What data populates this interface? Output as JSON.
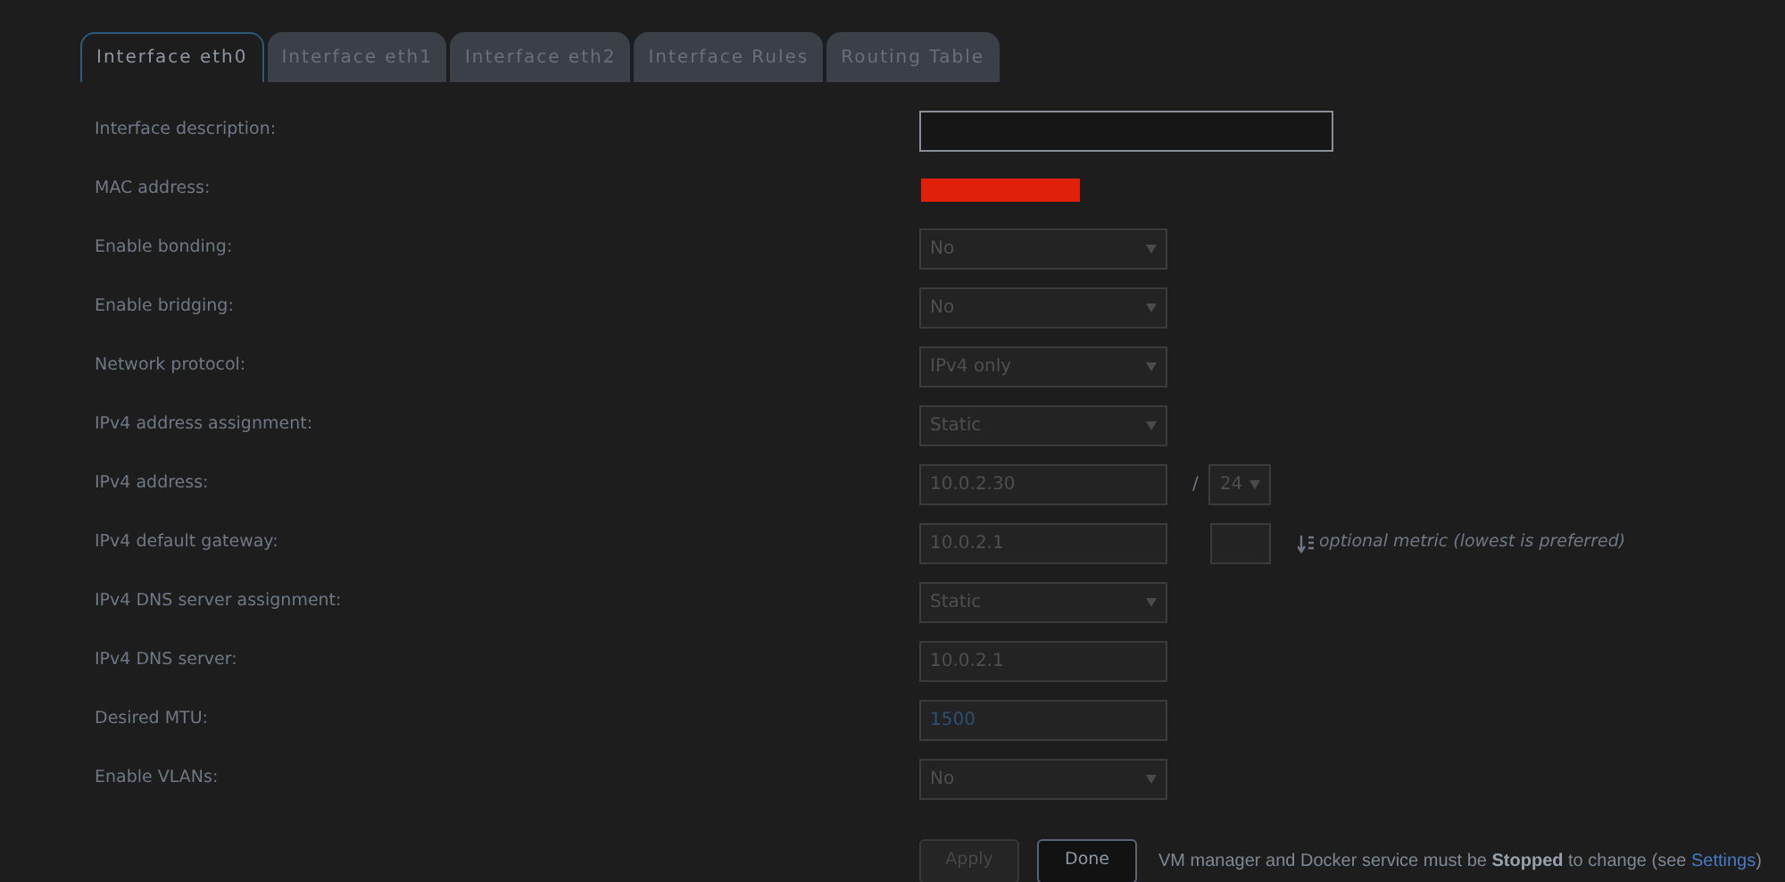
{
  "tabs": [
    {
      "label": "Interface eth0",
      "selected": true
    },
    {
      "label": "Interface eth1",
      "selected": false
    },
    {
      "label": "Interface eth2",
      "selected": false
    },
    {
      "label": "Interface Rules",
      "selected": false
    },
    {
      "label": "Routing Table",
      "selected": false
    }
  ],
  "rows": [
    {
      "label": "Interface description:",
      "kind": "text",
      "wide": true,
      "disabled": false
    },
    {
      "label": "MAC address:",
      "kind": "redacted"
    },
    {
      "label": "Enable bonding:",
      "kind": "select",
      "value": "No",
      "disabled": true
    },
    {
      "label": "Enable bridging:",
      "kind": "select",
      "value": "No",
      "disabled": true
    },
    {
      "label": "Network protocol:",
      "kind": "select",
      "value": "IPv4 only",
      "disabled": true
    },
    {
      "label": "IPv4 address assignment:",
      "kind": "select",
      "value": "Static",
      "disabled": true
    },
    {
      "label": "IPv4 address:",
      "kind": "address",
      "value": "10.0.2.30",
      "disabled": true,
      "separator": "/",
      "prefix": "24"
    },
    {
      "label": "IPv4 default gateway:",
      "kind": "gateway",
      "value": "10.0.2.1",
      "disabled": true,
      "note": "optional metric (lowest is preferred)"
    },
    {
      "label": "IPv4 DNS server assignment:",
      "kind": "select",
      "value": "Static",
      "disabled": true
    },
    {
      "label": "IPv4 DNS server:",
      "kind": "text",
      "value": "10.0.2.1",
      "disabled": true
    },
    {
      "label": "Desired MTU:",
      "kind": "text",
      "placeholder": "1500",
      "disabled": true
    },
    {
      "label": "Enable VLANs:",
      "kind": "select",
      "value": "No",
      "disabled": true
    }
  ],
  "buttons": [
    {
      "label": "Apply",
      "disabled": true
    },
    {
      "label": "Done",
      "disabled": false
    }
  ],
  "note": {
    "text": "VM manager and Docker service must be **Stopped** to change (see ",
    "link": "Settings",
    "end": ")"
  }
}
